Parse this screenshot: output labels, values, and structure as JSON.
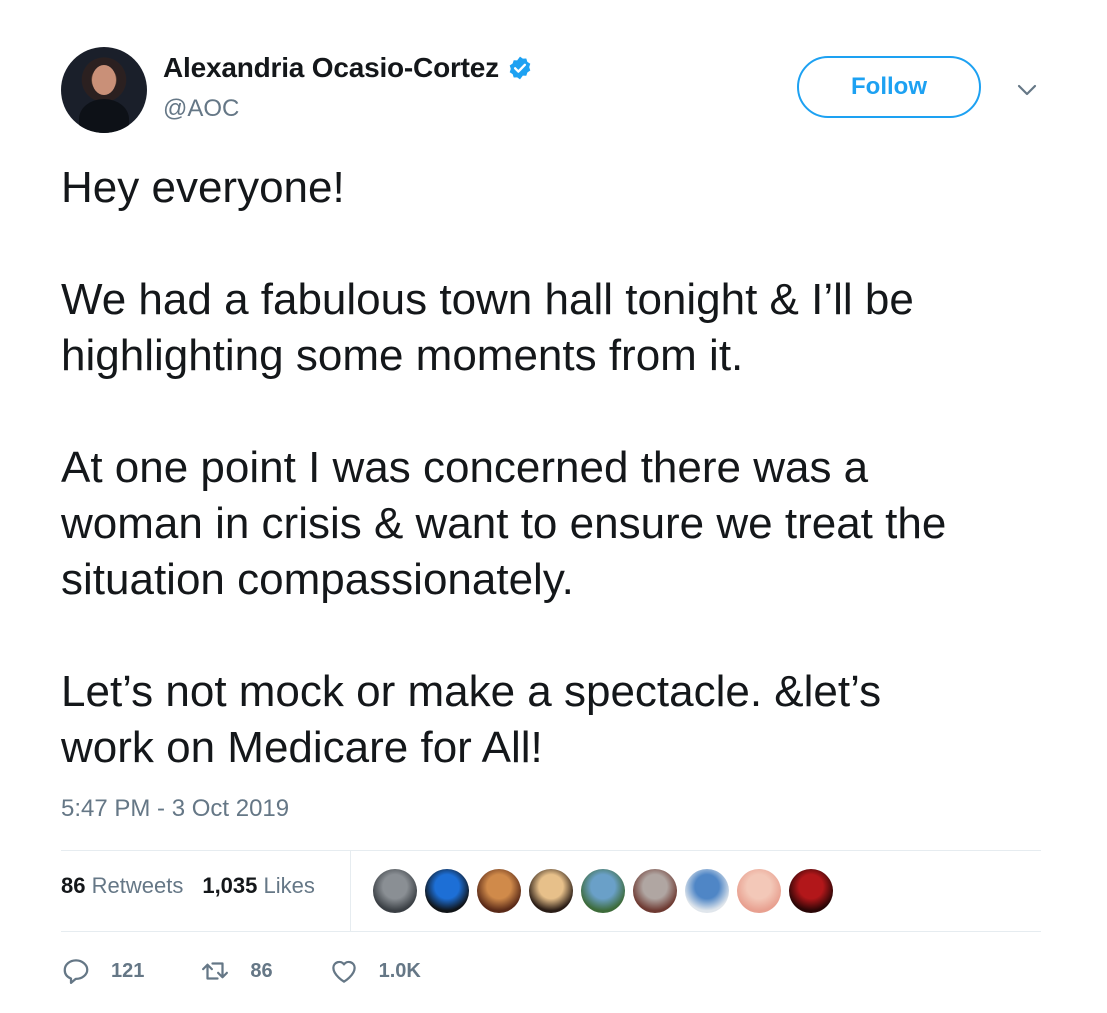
{
  "author": {
    "display_name": "Alexandria Ocasio-Cortez",
    "handle": "@AOC",
    "verified": true
  },
  "follow_label": "Follow",
  "tweet": {
    "paragraphs": [
      [
        "Hey everyone!"
      ],
      [
        "We had a fabulous town hall tonight & I’ll be",
        "highlighting some moments from it."
      ],
      [
        "At one point I was concerned there was a",
        "woman in crisis & want to ensure we treat the",
        "situation compassionately."
      ],
      [
        "Let’s not mock or make a spectacle. &let’s",
        "work on Medicare for All!"
      ]
    ],
    "timestamp": "5:47 PM - 3 Oct 2019"
  },
  "stats": {
    "retweets_count": "86",
    "retweets_label": "Retweets",
    "likes_count": "1,035",
    "likes_label": "Likes"
  },
  "liker_avatars": [
    {
      "colors": [
        "#8a8f94",
        "#3a3f44"
      ]
    },
    {
      "colors": [
        "#1d6fd6",
        "#101418"
      ]
    },
    {
      "colors": [
        "#d08a4a",
        "#5a2a18"
      ]
    },
    {
      "colors": [
        "#e7c08a",
        "#2a1d16"
      ]
    },
    {
      "colors": [
        "#6aa0c8",
        "#3d6b3a"
      ]
    },
    {
      "colors": [
        "#b0a6a2",
        "#6e3a32"
      ]
    },
    {
      "colors": [
        "#4f86c6",
        "#e0e6ec"
      ]
    },
    {
      "colors": [
        "#f3c8b8",
        "#e8a090"
      ]
    },
    {
      "colors": [
        "#b2171a",
        "#2a0606"
      ]
    }
  ],
  "actions": {
    "reply_count": "121",
    "retweet_count": "86",
    "like_count": "1.0K"
  },
  "colors": {
    "accent": "#1da1f2",
    "muted": "#657786",
    "text": "#14171a",
    "divider": "#e6ecf0"
  }
}
